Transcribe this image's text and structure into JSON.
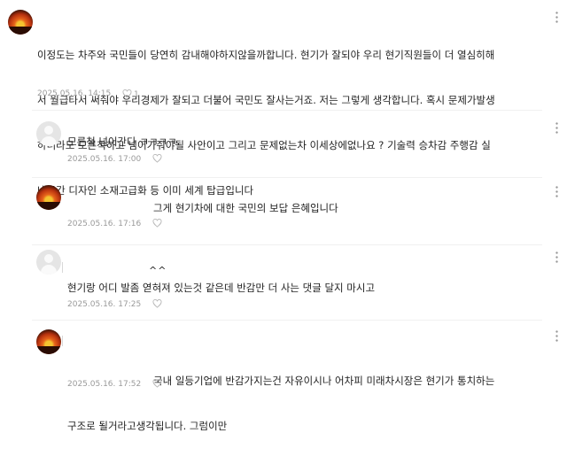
{
  "comments": [
    {
      "text": "이정도는 차주와 국민들이 당연히 감내해야하지않을까합니다. 현기가 잘되야 우리 현기직원들이 더 열심히해서 월급타서 써줘야 우리경제가 잘되고 더불어 국민도 잘사는거죠. 저는 그렇게 생각합니다. 혹시 문제가발생하더라도 모른척하고 넘어가줘야될 사안이고 그리고 문제없는차 이세상에없나요 ? 기술력 승차감 주행감 실내공간 디자인 소재고급화 등 이미 세계 탑급입니다",
      "lines": [
        "이정도는 차주와 국민들이 당연히 감내해야하지않을까합니다. 현기가 잘되야 우리 현기직원들이 더 열심히해",
        "서 월급타서 써줘야 우리경제가 잘되고 더불어 국민도 잘사는거죠. 저는 그렇게 생각합니다. 혹시 문제가발생",
        "하더라도 모른척하고 넘어가줘야될 사안이고 그리고 문제없는차 이세상에없나요 ? 기술력 승차감 주행감 실",
        "내공간 디자인 소재고급화 등 이미 세계 탑급입니다"
      ],
      "date": "2025.05.16. 14:15",
      "likes": "1",
      "avatar": "sunset"
    },
    {
      "text": "모른척 넘어간다 ㅋㅋㅋㅋ",
      "date": "2025.05.16. 17:00",
      "avatar": "default"
    },
    {
      "text": "그게 현기차에 대한 국민의 보답 은혜입니다",
      "date": "2025.05.16. 17:16",
      "avatar": "sunset"
    },
    {
      "caret": "^^",
      "text": "현기랑 어디 발좀 엳혀져 있는것 같은데 반감만 더 사는 댓글 달지 마시고",
      "date": "2025.05.16. 17:25",
      "avatar": "default"
    },
    {
      "text": "국내 일등기업에 반감가지는건 자유이시나 어차피 미래차시장은 현기가 통치하는 구조로 될거라고생각됩니다. 그럼이만",
      "lines": [
        "국내 일등기업에 반감가지는건 자유이시나 어차피 미래차시장은 현기가 통치하는",
        "구조로 될거라고생각됩니다. 그럼이만"
      ],
      "date": "2025.05.16. 17:52",
      "avatar": "sunset"
    }
  ],
  "colors": {
    "meta": "#9a9a9a",
    "heart": "#b8b8b8",
    "divider": "#f0f0f0"
  },
  "icons": {
    "more": "more-vertical-icon",
    "like": "heart-icon"
  }
}
